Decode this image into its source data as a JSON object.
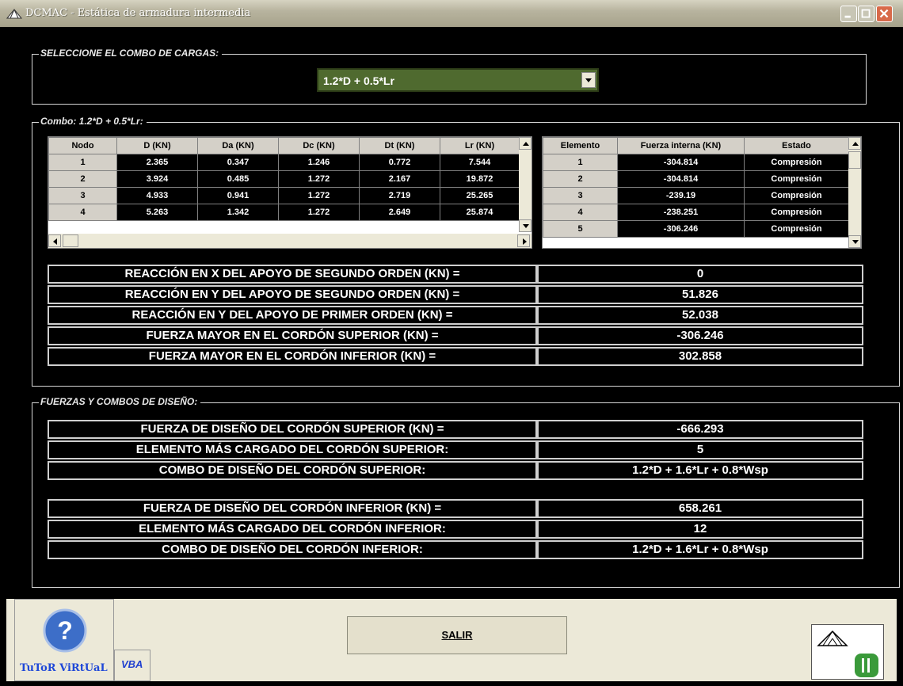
{
  "window": {
    "title": "DCMAC - Estática de armadura intermedia"
  },
  "select_group": {
    "legend": "SELECCIONE EL COMBO DE CARGAS:",
    "combo_value": "1.2*D + 0.5*Lr"
  },
  "results_group": {
    "legend": "Combo: 1.2*D + 0.5*Lr:",
    "nodes_table": {
      "headers": [
        "Nodo",
        "D (KN)",
        "Da (KN)",
        "Dc (KN)",
        "Dt (KN)",
        "Lr (KN)"
      ],
      "rows": [
        [
          "1",
          "2.365",
          "0.347",
          "1.246",
          "0.772",
          "7.544"
        ],
        [
          "2",
          "3.924",
          "0.485",
          "1.272",
          "2.167",
          "19.872"
        ],
        [
          "3",
          "4.933",
          "0.941",
          "1.272",
          "2.719",
          "25.265"
        ],
        [
          "4",
          "5.263",
          "1.342",
          "1.272",
          "2.649",
          "25.874"
        ]
      ]
    },
    "elements_table": {
      "headers": [
        "Elemento",
        "Fuerza interna (KN)",
        "Estado"
      ],
      "rows": [
        [
          "1",
          "-304.814",
          "Compresión"
        ],
        [
          "2",
          "-304.814",
          "Compresión"
        ],
        [
          "3",
          "-239.19",
          "Compresión"
        ],
        [
          "4",
          "-238.251",
          "Compresión"
        ],
        [
          "5",
          "-306.246",
          "Compresión"
        ]
      ]
    },
    "reactions": [
      {
        "label": "REACCIÓN EN X DEL APOYO DE SEGUNDO ORDEN (KN) =",
        "value": "0"
      },
      {
        "label": "REACCIÓN EN Y DEL APOYO DE SEGUNDO ORDEN (KN) =",
        "value": "51.826"
      },
      {
        "label": "REACCIÓN EN Y DEL APOYO DE PRIMER ORDEN (KN) =",
        "value": "52.038"
      },
      {
        "label": "FUERZA MAYOR EN EL CORDÓN SUPERIOR (KN) =",
        "value": "-306.246"
      },
      {
        "label": "FUERZA MAYOR EN EL CORDÓN INFERIOR (KN) =",
        "value": "302.858"
      }
    ]
  },
  "design_group": {
    "legend": "FUERZAS Y COMBOS DE DISEÑO:",
    "superior": [
      {
        "label": "FUERZA DE DISEÑO DEL CORDÓN SUPERIOR (KN) =",
        "value": "-666.293"
      },
      {
        "label": "ELEMENTO MÁS CARGADO DEL CORDÓN SUPERIOR:",
        "value": "5"
      },
      {
        "label": "COMBO DE DISEÑO DEL CORDÓN SUPERIOR:",
        "value": "1.2*D + 1.6*Lr + 0.8*Wsp"
      }
    ],
    "inferior": [
      {
        "label": "FUERZA DE DISEÑO DEL CORDÓN INFERIOR (KN) =",
        "value": "658.261"
      },
      {
        "label": "ELEMENTO MÁS CARGADO DEL CORDÓN INFERIOR:",
        "value": "12"
      },
      {
        "label": "COMBO DE DISEÑO DEL CORDÓN INFERIOR:",
        "value": "1.2*D + 1.6*Lr + 0.8*Wsp"
      }
    ]
  },
  "footer": {
    "tutor_label": "TuToR ViRtUaL",
    "vba_label": "VBA",
    "salir_label": "SALIR"
  },
  "colors": {
    "accent_combo": "#4f6a2f",
    "tutor_text": "#1f48d8"
  },
  "icons": [
    "app-truss-icon",
    "minimize-icon",
    "maximize-icon",
    "close-icon",
    "help-question-icon",
    "truss-logo-icon"
  ]
}
